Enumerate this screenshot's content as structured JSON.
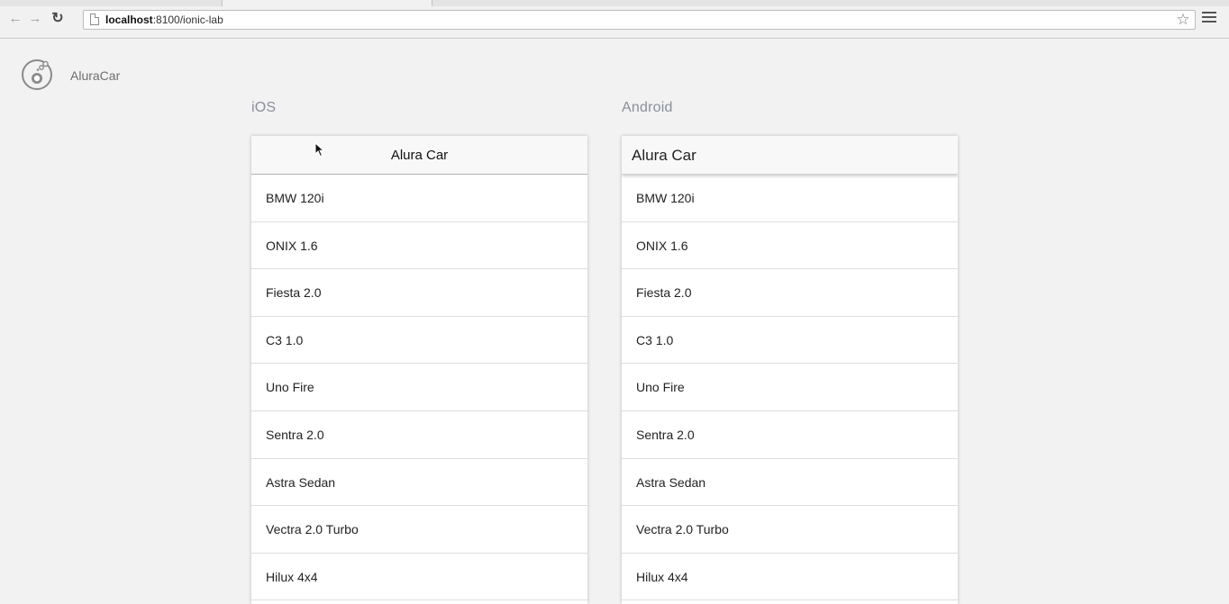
{
  "browser": {
    "url_host": "localhost",
    "url_path": ":8100/ionic-lab",
    "back_icon": "back-arrow-icon",
    "forward_icon": "forward-arrow-icon",
    "reload_icon": "reload-icon",
    "star_icon": "star-icon",
    "menu_icon": "hamburger-menu-icon"
  },
  "app": {
    "name": "AluraCar",
    "logo_icon": "ionic-lab-flask-icon"
  },
  "platforms": {
    "ios": {
      "label": "iOS",
      "toolbar_title": "Alura Car",
      "items": [
        {
          "label": "BMW 120i"
        },
        {
          "label": "ONIX 1.6"
        },
        {
          "label": "Fiesta 2.0"
        },
        {
          "label": "C3 1.0"
        },
        {
          "label": "Uno Fire"
        },
        {
          "label": "Sentra 2.0"
        },
        {
          "label": "Astra Sedan"
        },
        {
          "label": "Vectra 2.0 Turbo"
        },
        {
          "label": "Hilux 4x4"
        }
      ]
    },
    "android": {
      "label": "Android",
      "toolbar_title": "Alura Car",
      "items": [
        {
          "label": "BMW 120i"
        },
        {
          "label": "ONIX 1.6"
        },
        {
          "label": "Fiesta 2.0"
        },
        {
          "label": "C3 1.0"
        },
        {
          "label": "Uno Fire"
        },
        {
          "label": "Sentra 2.0"
        },
        {
          "label": "Astra Sedan"
        },
        {
          "label": "Vectra 2.0 Turbo"
        },
        {
          "label": "Hilux 4x4"
        }
      ]
    }
  },
  "colors": {
    "page_background": "#f2f2f3",
    "platform_label": "#8a8f99"
  }
}
